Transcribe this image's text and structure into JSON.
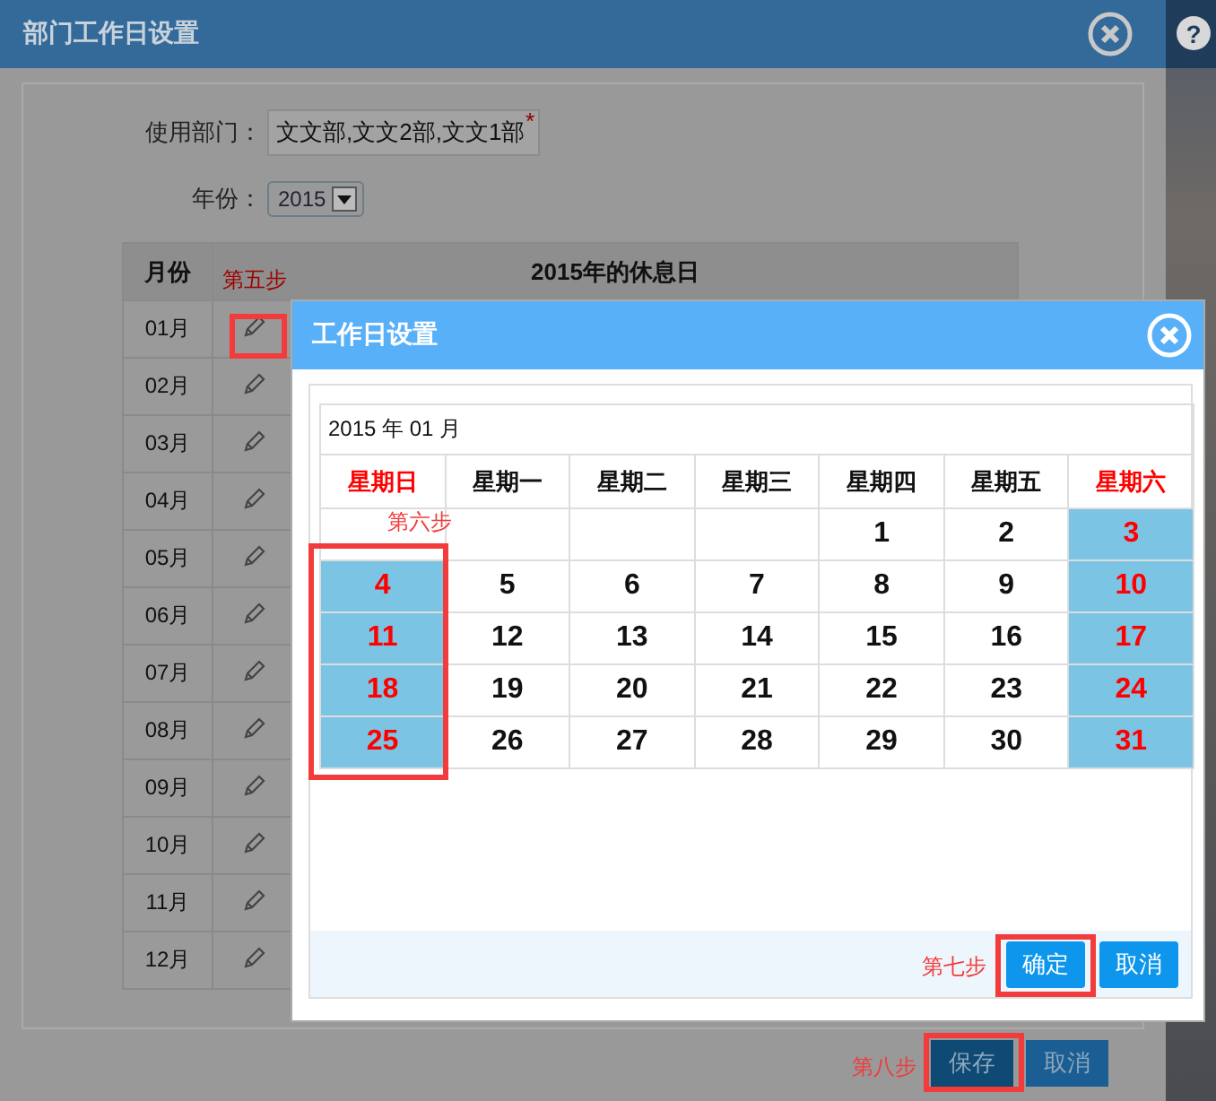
{
  "background": {
    "help_symbol": "?"
  },
  "outer_dialog": {
    "title": "部门工作日设置",
    "department": {
      "label": "使用部门：",
      "value": "文文部,文文2部,文文1部",
      "required_mark": "*"
    },
    "year": {
      "label": "年份：",
      "value": "2015"
    },
    "table": {
      "columns": [
        "月份",
        "2015年的休息日"
      ],
      "rows": [
        {
          "month": "01月"
        },
        {
          "month": "02月"
        },
        {
          "month": "03月"
        },
        {
          "month": "04月"
        },
        {
          "month": "05月"
        },
        {
          "month": "06月"
        },
        {
          "month": "07月"
        },
        {
          "month": "08月"
        },
        {
          "month": "09月"
        },
        {
          "month": "10月"
        },
        {
          "month": "11月"
        },
        {
          "month": "12月"
        }
      ]
    },
    "buttons": [
      "保存",
      "取消"
    ]
  },
  "inner_dialog": {
    "title": "工作日设置",
    "month_label": "2015 年 01 月",
    "weekdays": [
      {
        "label": "星期日",
        "weekend": true
      },
      {
        "label": "星期一",
        "weekend": false
      },
      {
        "label": "星期二",
        "weekend": false
      },
      {
        "label": "星期三",
        "weekend": false
      },
      {
        "label": "星期四",
        "weekend": false
      },
      {
        "label": "星期五",
        "weekend": false
      },
      {
        "label": "星期六",
        "weekend": true
      }
    ],
    "weeks": [
      [
        {
          "kind": "blank"
        },
        {
          "kind": "blank"
        },
        {
          "kind": "blank"
        },
        {
          "kind": "blank"
        },
        {
          "kind": "day",
          "day": "1",
          "rest": false
        },
        {
          "kind": "day",
          "day": "2",
          "rest": false
        },
        {
          "kind": "day",
          "day": "3",
          "rest": true
        }
      ],
      [
        {
          "kind": "day",
          "day": "4",
          "rest": true
        },
        {
          "kind": "day",
          "day": "5",
          "rest": false
        },
        {
          "kind": "day",
          "day": "6",
          "rest": false
        },
        {
          "kind": "day",
          "day": "7",
          "rest": false
        },
        {
          "kind": "day",
          "day": "8",
          "rest": false
        },
        {
          "kind": "day",
          "day": "9",
          "rest": false
        },
        {
          "kind": "day",
          "day": "10",
          "rest": true
        }
      ],
      [
        {
          "kind": "day",
          "day": "11",
          "rest": true
        },
        {
          "kind": "day",
          "day": "12",
          "rest": false
        },
        {
          "kind": "day",
          "day": "13",
          "rest": false
        },
        {
          "kind": "day",
          "day": "14",
          "rest": false
        },
        {
          "kind": "day",
          "day": "15",
          "rest": false
        },
        {
          "kind": "day",
          "day": "16",
          "rest": false
        },
        {
          "kind": "day",
          "day": "17",
          "rest": true
        }
      ],
      [
        {
          "kind": "day",
          "day": "18",
          "rest": true
        },
        {
          "kind": "day",
          "day": "19",
          "rest": false
        },
        {
          "kind": "day",
          "day": "20",
          "rest": false
        },
        {
          "kind": "day",
          "day": "21",
          "rest": false
        },
        {
          "kind": "day",
          "day": "22",
          "rest": false
        },
        {
          "kind": "day",
          "day": "23",
          "rest": false
        },
        {
          "kind": "day",
          "day": "24",
          "rest": true
        }
      ],
      [
        {
          "kind": "day",
          "day": "25",
          "rest": true
        },
        {
          "kind": "day",
          "day": "26",
          "rest": false
        },
        {
          "kind": "day",
          "day": "27",
          "rest": false
        },
        {
          "kind": "day",
          "day": "28",
          "rest": false
        },
        {
          "kind": "day",
          "day": "29",
          "rest": false
        },
        {
          "kind": "day",
          "day": "30",
          "rest": false
        },
        {
          "kind": "day",
          "day": "31",
          "rest": true
        }
      ]
    ],
    "buttons": [
      "确定",
      "取消"
    ]
  },
  "annotations": [
    {
      "label": "第五步"
    },
    {
      "label": "第六步"
    },
    {
      "label": "第七步"
    },
    {
      "label": "第八步"
    }
  ]
}
